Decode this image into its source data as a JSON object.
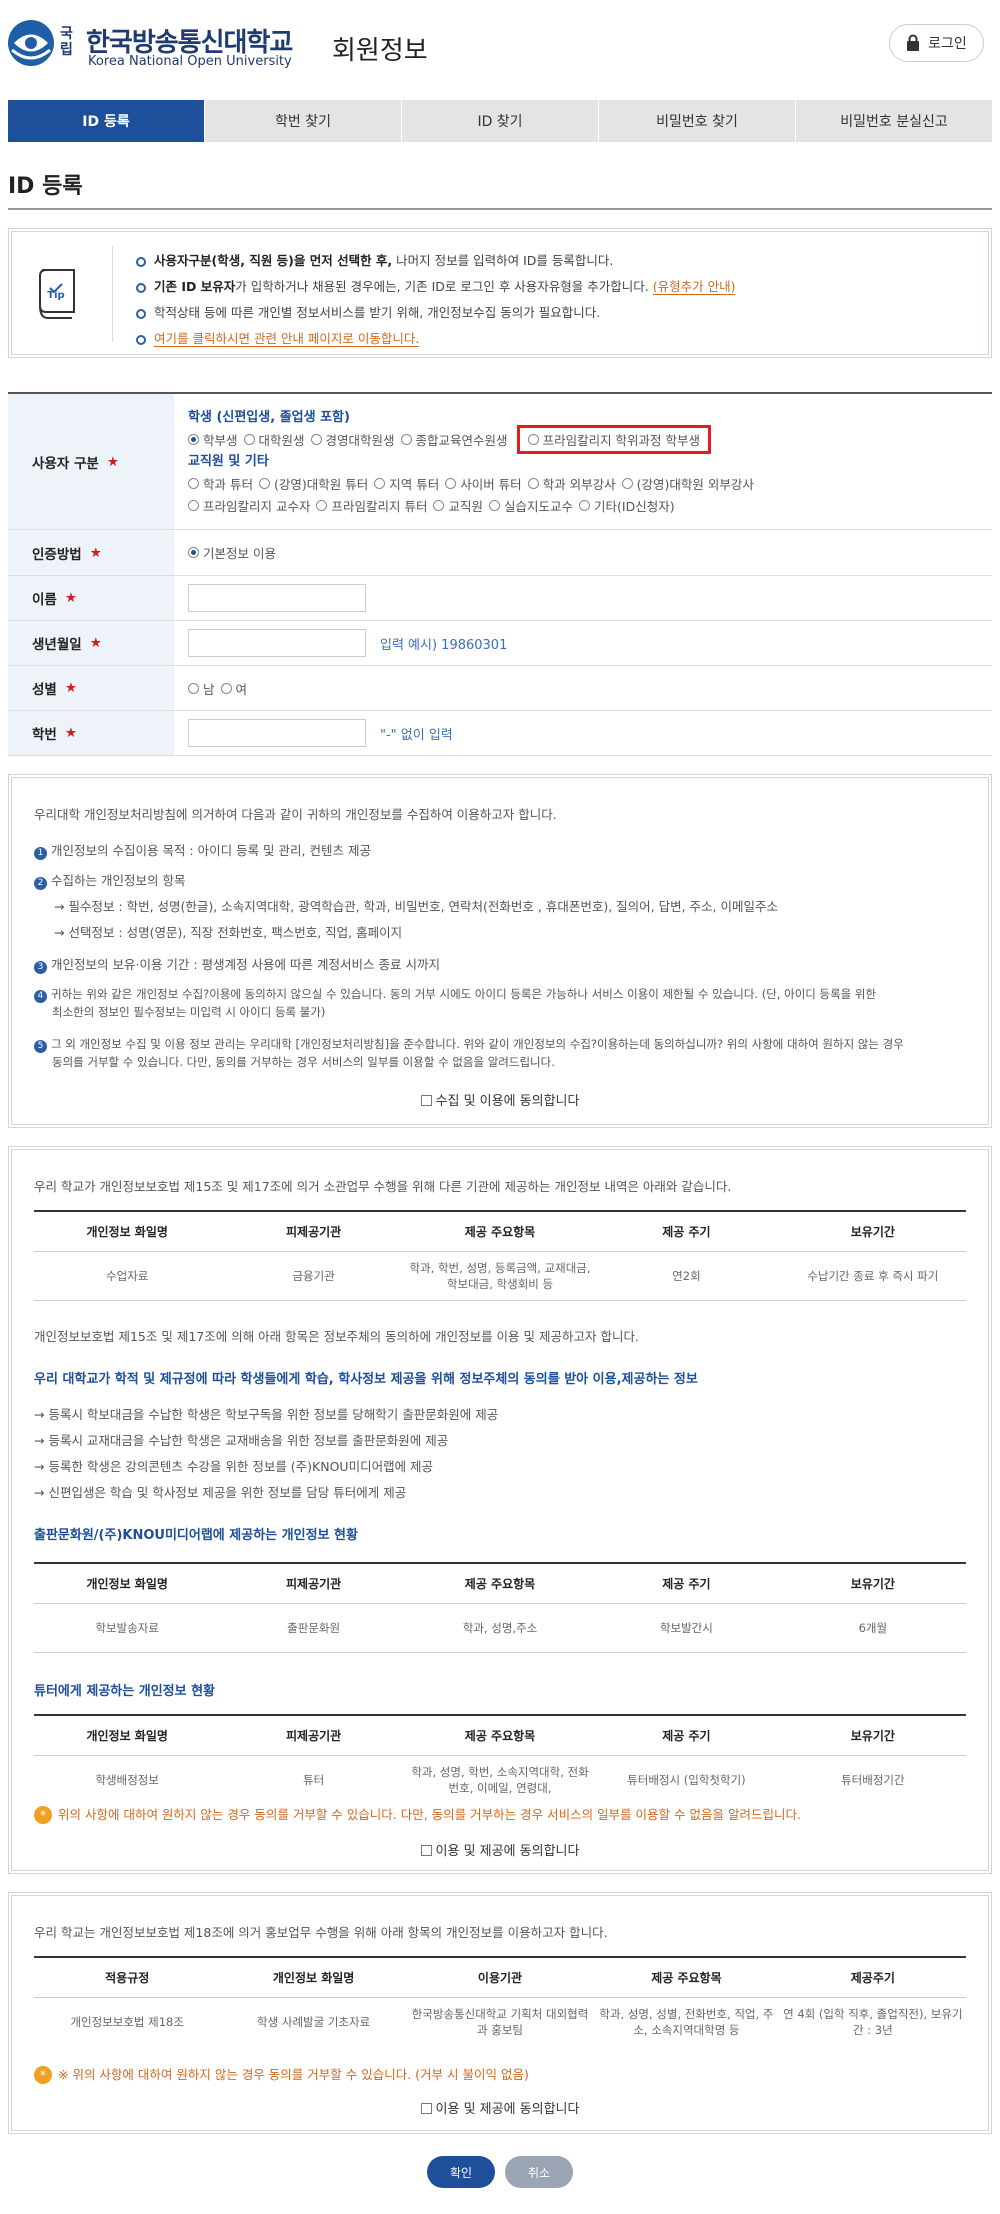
{
  "header": {
    "logo_small": "국립",
    "logo_korean": "한국방송통신대학교",
    "logo_english": "Korea National Open University",
    "page_heading": "회원정보",
    "login_label": "로그인"
  },
  "tabs": [
    {
      "label": "ID 등록",
      "active": true
    },
    {
      "label": "학번 찾기",
      "active": false
    },
    {
      "label": "ID 찾기",
      "active": false
    },
    {
      "label": "비밀번호 찾기",
      "active": false
    },
    {
      "label": "비밀번호 분실신고",
      "active": false
    }
  ],
  "section_title": "ID 등록",
  "tip": {
    "icon_label": "Tip",
    "items": [
      {
        "bold": "사용자구분(학생, 직원 등)을 먼저 선택한 후,",
        "text": " 나머지 정보를 입력하여 ID를 등록합니다."
      },
      {
        "bold": "기존 ID 보유자",
        "text": "가 입학하거나 채용된 경우에는, 기존 ID로 로그인 후 사용자유형을 추가합니다.",
        "link": "(유형추가 안내)"
      },
      {
        "bold": "",
        "text": "학적상태 등에 따른 개인별 정보서비스를 받기 위해, 개인정보수집 동의가 필요합니다."
      },
      {
        "bold": "",
        "text": "",
        "link": "여기를 클릭하시면 관련 안내 페이지로 이동합니다."
      }
    ]
  },
  "form": {
    "user_type": {
      "label": "사용자 구분",
      "student_group": "학생 (신편입생, 졸업생 포함)",
      "student_options": [
        "학부생",
        "대학원생",
        "경영대학원생",
        "종합교육연수원생"
      ],
      "highlighted_option": "프라임칼리지 학위과정 학부생",
      "staff_group": "교직원 및 기타",
      "staff_line1": [
        "학과 튜터",
        "(강영)대학원 튜터",
        "지역 튜터",
        "사이버 튜터",
        "학과 외부강사",
        "(강영)대학원 외부강사"
      ],
      "staff_line2": [
        "프라임칼리지 교수자",
        "프라임칼리지 튜터",
        "교직원",
        "실습지도교수",
        "기타(ID신청자)"
      ]
    },
    "auth": {
      "label": "인증방법",
      "option": "기본정보 이용"
    },
    "name": {
      "label": "이름"
    },
    "birth": {
      "label": "생년월일",
      "hint": "입력 예시) 19860301"
    },
    "gender": {
      "label": "성별",
      "options": [
        "남",
        "여"
      ]
    },
    "student_no": {
      "label": "학번",
      "hint": "\"-\" 없이 입력"
    }
  },
  "consent1": {
    "intro": "우리대학 개인정보처리방침에 의거하여 다음과 같이 귀하의 개인정보를 수집하여 이용하고자 합니다.",
    "i1": "개인정보의 수집이용 목적 : 아이디 등록 및 관리, 컨텐츠 제공",
    "i2": "수집하는 개인정보의 항목",
    "i2a": "→ 필수정보 : 학번, 성명(한글), 소속지역대학, 광역학습관, 학과, 비밀번호, 연락처(전화번호 , 휴대폰번호), 질의어, 답변, 주소, 이메일주소",
    "i2b": "→ 선택정보 : 성명(영문), 직장 전화번호, 팩스번호, 직업, 홈페이지",
    "i3": "개인정보의 보유·이용 기간 : 평생계정 사용에 따른 계정서비스 종료 시까지",
    "i4a": "귀하는 위와 같은 개인정보 수집?이용에 동의하지 않으실 수 있습니다. 동의 거부 시에도 아이디 등록은 가능하나 서비스 이용이 제한될 수 있습니다. (단, 아이디 등록을 위한",
    "i4b": "최소한의 정보인 필수정보는 미입력 시 아이디 등록 불가)",
    "i5a": "그 외 개인정보 수집 및 이용 정보 관리는 우리대학 [개인정보처리방침]을 준수합니다. 위와 같이 개인정보의 수집?이용하는데 동의하십니까? 위의 사항에 대하여 원하지 않는 경우",
    "i5b": "동의를 거부할 수 있습니다. 다만, 동의를 거부하는 경우 서비스의 일부를 이용할 수 없음을 알려드립니다.",
    "agree": "수집 및 이용에 동의합니다"
  },
  "consent2": {
    "intro": "우리 학교가 개인정보보호법 제15조 및 제17조에 의거 소관업무 수행을 위해 다른 기관에 제공하는 개인정보 내역은 아래와 같습니다.",
    "headers": [
      "개인정보 화일명",
      "피제공기관",
      "제공 주요항목",
      "제공 주기",
      "보유기간"
    ],
    "row1": [
      "수업자료",
      "금융기관",
      "학과, 학번, 성명, 등록금액, 교재대금,학보대금, 학생회비 등",
      "연2회",
      "수납기간 종료 후 즉시 파기"
    ],
    "note": "개인정보보호법 제15조 및 제17조에 의해 아래 항목은 정보주체의 동의하에 개인정보를 이용 및 제공하고자 합니다.",
    "blue1": "우리 대학교가 학적 및 제규정에 따라 학생들에게 학습, 학사정보 제공을 위해 정보주체의 동의를 받아 이용,제공하는 정보",
    "list": [
      "→ 등록시 학보대금을 수납한 학생은 학보구독을 위한 정보를 당해학기 출판문화원에 제공",
      "→ 등록시 교재대금을 수납한 학생은 교재배송을 위한 정보를 출판문화원에 제공",
      "→ 등록한 학생은 강의콘텐츠 수강을 위한 정보를 (주)KNOU미디어랩에 제공",
      "→ 신편입생은 학습 및 학사정보 제공을 위한 정보를 담당 튜터에게 제공"
    ],
    "blue2": "출판문화원/(주)KNOU미디어랩에 제공하는 개인정보 현황",
    "row2": [
      "학보발송자료",
      "출판문화원",
      "학과, 성명,주소",
      "학보발간시",
      "6개월"
    ],
    "blue3": "튜터에게 제공하는 개인정보 현황",
    "row3": [
      "학생배정정보",
      "튜터",
      "학과, 성명, 학번, 소속지역대학, 전화번호, 이메일, 연령대,",
      "튜터배정시 (입학첫학기)",
      "튜터배정기간"
    ],
    "warn": "위의 사항에 대하여 원하지 않는 경우 동의를 거부할 수 있습니다. 다만, 동의를 거부하는 경우 서비스의 일부를 이용할 수 없음을 알려드립니다.",
    "agree": "이용 및 제공에 동의합니다"
  },
  "consent3": {
    "intro": "우리 학교는 개인정보보호법 제18조에 의거 홍보업무 수행을 위해 아래 항목의 개인정보를 이용하고자 합니다.",
    "headers": [
      "적용규정",
      "개인정보 화일명",
      "이용기관",
      "제공 주요항목",
      "제공주기"
    ],
    "row": [
      "개인정보보호법 제18조",
      "학생 사례발굴 기초자료",
      "한국방송통신대학교 기획처 대외협력과 홍보팀",
      "학과, 성명, 성별, 전화번호, 직업, 주소, 소속지역대학명 등",
      "연 4회 (입학 직후, 졸업직전), 보유기간 : 3년"
    ],
    "warn": "※ 위의 사항에 대하여 원하지 않는 경우 동의를 거부할 수 있습니다. (거부 시 불이익 없음)",
    "agree": "이용 및 제공에 동의합니다"
  },
  "buttons": {
    "ok": "확인",
    "cancel": "취소"
  }
}
